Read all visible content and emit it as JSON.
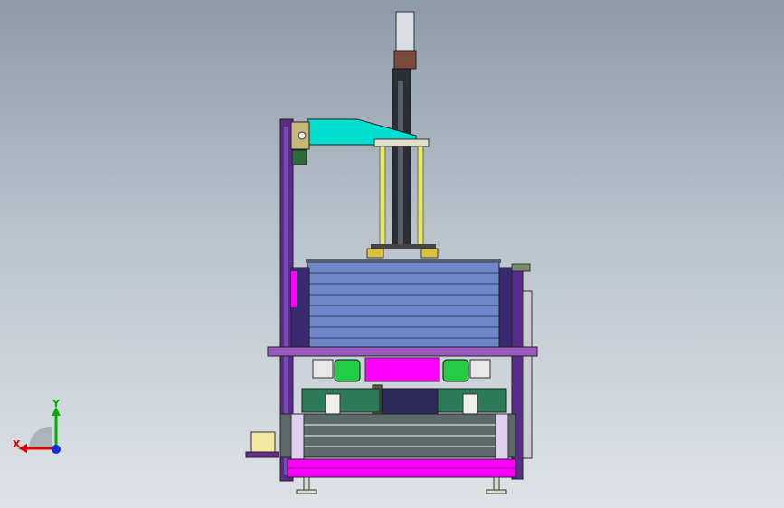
{
  "viewport": {
    "background_top": "#8d9aa8",
    "background_bottom": "#dfe3e7"
  },
  "model": {
    "description_icon": "cad-machine-front-view",
    "colors": {
      "frame_purple": "#5a2a8c",
      "magenta": "#ff00ff",
      "cyan_arm": "#00e0d0",
      "green": "#22cc44",
      "slate_blue": "#6f86c8",
      "yellow_rod": "#e8e860",
      "dark": "#222222",
      "grey": "#9aa0a8"
    }
  },
  "triad": {
    "x_label": "X",
    "y_label": "Y",
    "x_color": "#e00000",
    "y_color": "#00b000",
    "z_color": "#1030e0"
  }
}
